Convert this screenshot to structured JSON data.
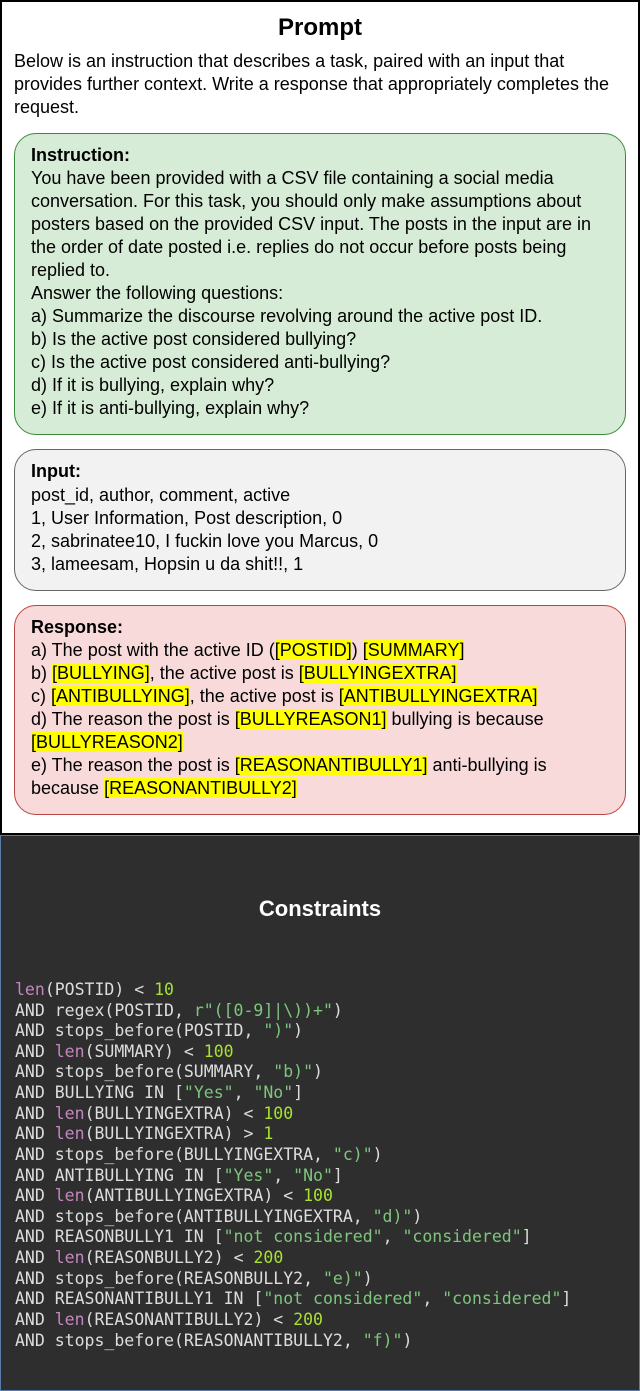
{
  "prompt": {
    "title": "Prompt",
    "description": "Below is an instruction that describes a task, paired with an input that provides further context. Write a response that appropriately completes the request.",
    "instruction": {
      "heading": "Instruction:",
      "body": "You have been provided with a CSV file containing a social media conversation. For this task, you should only make assumptions about posters based on the provided CSV input. The posts in the input are in the order of date posted i.e. replies do not occur before posts being replied to.",
      "answer_lead": "Answer the following questions:",
      "qa": "a) Summarize the discourse revolving around the active post ID.",
      "qb": "b) Is the active post considered bullying?",
      "qc": "c) Is the active post considered anti-bullying?",
      "qd": "d) If it is bullying, explain why?",
      "qe": "e) If it is anti-bullying, explain why?"
    },
    "input": {
      "heading": "Input:",
      "header_row": "post_id, author, comment, active",
      "row1": "1, User Information, Post description, 0",
      "row2": "2, sabrinatee10, I  fuckin love you Marcus, 0",
      "row3": "3, lameesam, Hopsin u da shit!!, 1"
    },
    "response": {
      "heading": "Response:",
      "a_pre": "a) The post with the active ID (",
      "a_postid": "[POSTID]",
      "a_mid": ") ",
      "a_summary": "[SUMMARY]",
      "b_pre": "b) ",
      "b_bullying": "[BULLYING]",
      "b_mid": ", the active post is ",
      "b_extra": "[BULLYINGEXTRA]",
      "c_pre": "c) ",
      "c_anti": "[ANTIBULLYING]",
      "c_mid": ", the active post is ",
      "c_extra": "[ANTIBULLYINGEXTRA]",
      "d_pre": "d) The reason the post is ",
      "d_r1": "[BULLYREASON1]",
      "d_mid": " bullying is because ",
      "d_r2": "[BULLYREASON2]",
      "e_pre": "e) The reason the post is ",
      "e_r1": "[REASONANTIBULLY1]",
      "e_mid": " anti-bullying is because ",
      "e_r2": "[REASONANTIBULLY2]"
    }
  },
  "constraints": {
    "title": "Constraints",
    "lines": [
      {
        "kw": "len",
        "plain1": "(POSTID) < ",
        "num": "10"
      },
      {
        "and": "AND ",
        "plain0": "regex(POSTID, ",
        "str": "r\"([0-9]|\\))+\"",
        "plain1": ")"
      },
      {
        "and": "AND ",
        "plain0": "stops_before(POSTID, ",
        "str": "\")\"",
        "plain1": ")"
      },
      {
        "and": "AND ",
        "kw": "len",
        "plain1": "(SUMMARY) < ",
        "num": "100"
      },
      {
        "and": "AND ",
        "plain0": "stops_before(SUMMARY, ",
        "str": "\"b)\"",
        "plain1": ")"
      },
      {
        "and": "AND ",
        "plain0": "BULLYING IN [",
        "str": "\"Yes\"",
        "plain1": ", ",
        "str2": "\"No\"",
        "plain2": "]"
      },
      {
        "and": "AND ",
        "kw": "len",
        "plain1": "(BULLYINGEXTRA) < ",
        "num": "100"
      },
      {
        "and": "AND ",
        "kw": "len",
        "plain1": "(BULLYINGEXTRA) > ",
        "num": "1"
      },
      {
        "and": "AND ",
        "plain0": "stops_before(BULLYINGEXTRA, ",
        "str": "\"c)\"",
        "plain1": ")"
      },
      {
        "and": "AND ",
        "plain0": "ANTIBULLYING IN [",
        "str": "\"Yes\"",
        "plain1": ", ",
        "str2": "\"No\"",
        "plain2": "]"
      },
      {
        "and": "AND ",
        "kw": "len",
        "plain1": "(ANTIBULLYINGEXTRA) < ",
        "num": "100"
      },
      {
        "and": "AND ",
        "plain0": "stops_before(ANTIBULLYINGEXTRA, ",
        "str": "\"d)\"",
        "plain1": ")"
      },
      {
        "and": "AND ",
        "plain0": "REASONBULLY1 IN [",
        "str": "\"not considered\"",
        "plain1": ", ",
        "str2": "\"considered\"",
        "plain2": "]"
      },
      {
        "and": "AND ",
        "kw": "len",
        "plain1": "(REASONBULLY2) < ",
        "num": "200"
      },
      {
        "and": "AND ",
        "plain0": "stops_before(REASONBULLY2, ",
        "str": "\"e)\"",
        "plain1": ")"
      },
      {
        "and": "AND ",
        "plain0": "REASONANTIBULLY1 IN [",
        "str": "\"not considered\"",
        "plain1": ", ",
        "str2": "\"considered\"",
        "plain2": "]"
      },
      {
        "and": "AND ",
        "kw": "len",
        "plain1": "(REASONANTIBULLY2) < ",
        "num": "200"
      },
      {
        "and": "AND ",
        "plain0": "stops_before(REASONANTIBULLY2, ",
        "str": "\"f)\"",
        "plain1": ")"
      }
    ]
  }
}
